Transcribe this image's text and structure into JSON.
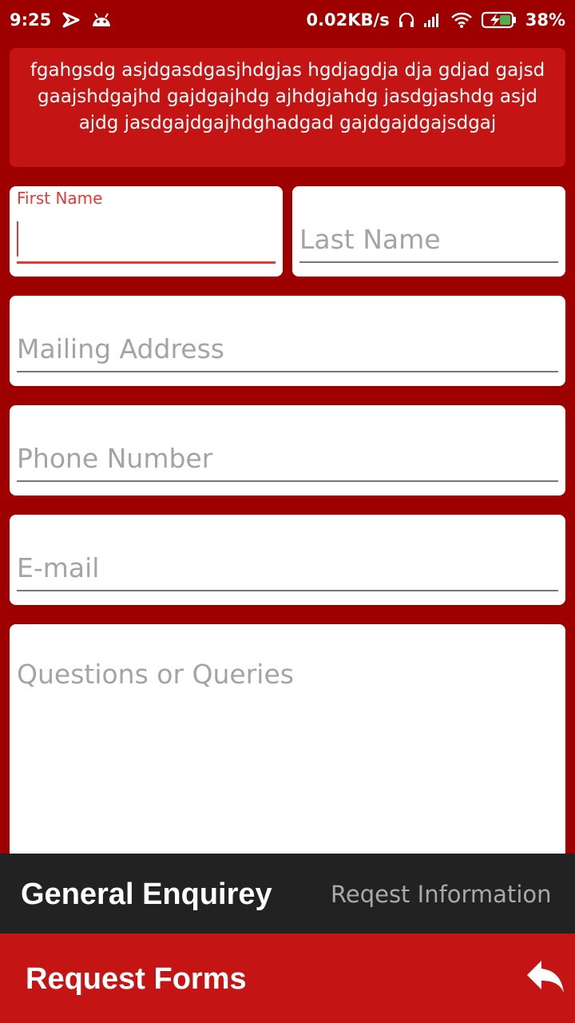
{
  "status_bar": {
    "time": "9:25",
    "net_speed": "0.02KB/s",
    "battery": "38%",
    "icons": [
      "notification-app-icon",
      "android-icon",
      "headset-icon",
      "signal-icon",
      "wifi-icon",
      "battery-charging-icon"
    ]
  },
  "banner": {
    "text": "fgahgsdg asjdgasdgasjhdgjas hgdjagdja dja gdjad gajsd gaajshdgajhd gajdgajhdg ajhdgjahdg jasdgjashdg asjd ajdg jasdgajdgajhdghadgad gajdgajdgajsdgaj"
  },
  "form": {
    "first_name": {
      "label": "First Name",
      "value": ""
    },
    "last_name": {
      "placeholder": "Last Name",
      "value": ""
    },
    "mailing_address": {
      "placeholder": "Mailing Address",
      "value": ""
    },
    "phone_number": {
      "placeholder": "Phone Number",
      "value": ""
    },
    "email": {
      "placeholder": "E-mail",
      "value": ""
    },
    "queries": {
      "placeholder": "Questions or Queries",
      "value": ""
    }
  },
  "tabs": {
    "active": "General Enquirey",
    "inactive": "Reqest Information"
  },
  "bottom_bar": {
    "title": "Request Forms",
    "action_icon": "reply-icon"
  },
  "colors": {
    "background": "#9e0000",
    "primary": "#c41414",
    "accent": "#e53935",
    "tab_bar": "#222222"
  }
}
